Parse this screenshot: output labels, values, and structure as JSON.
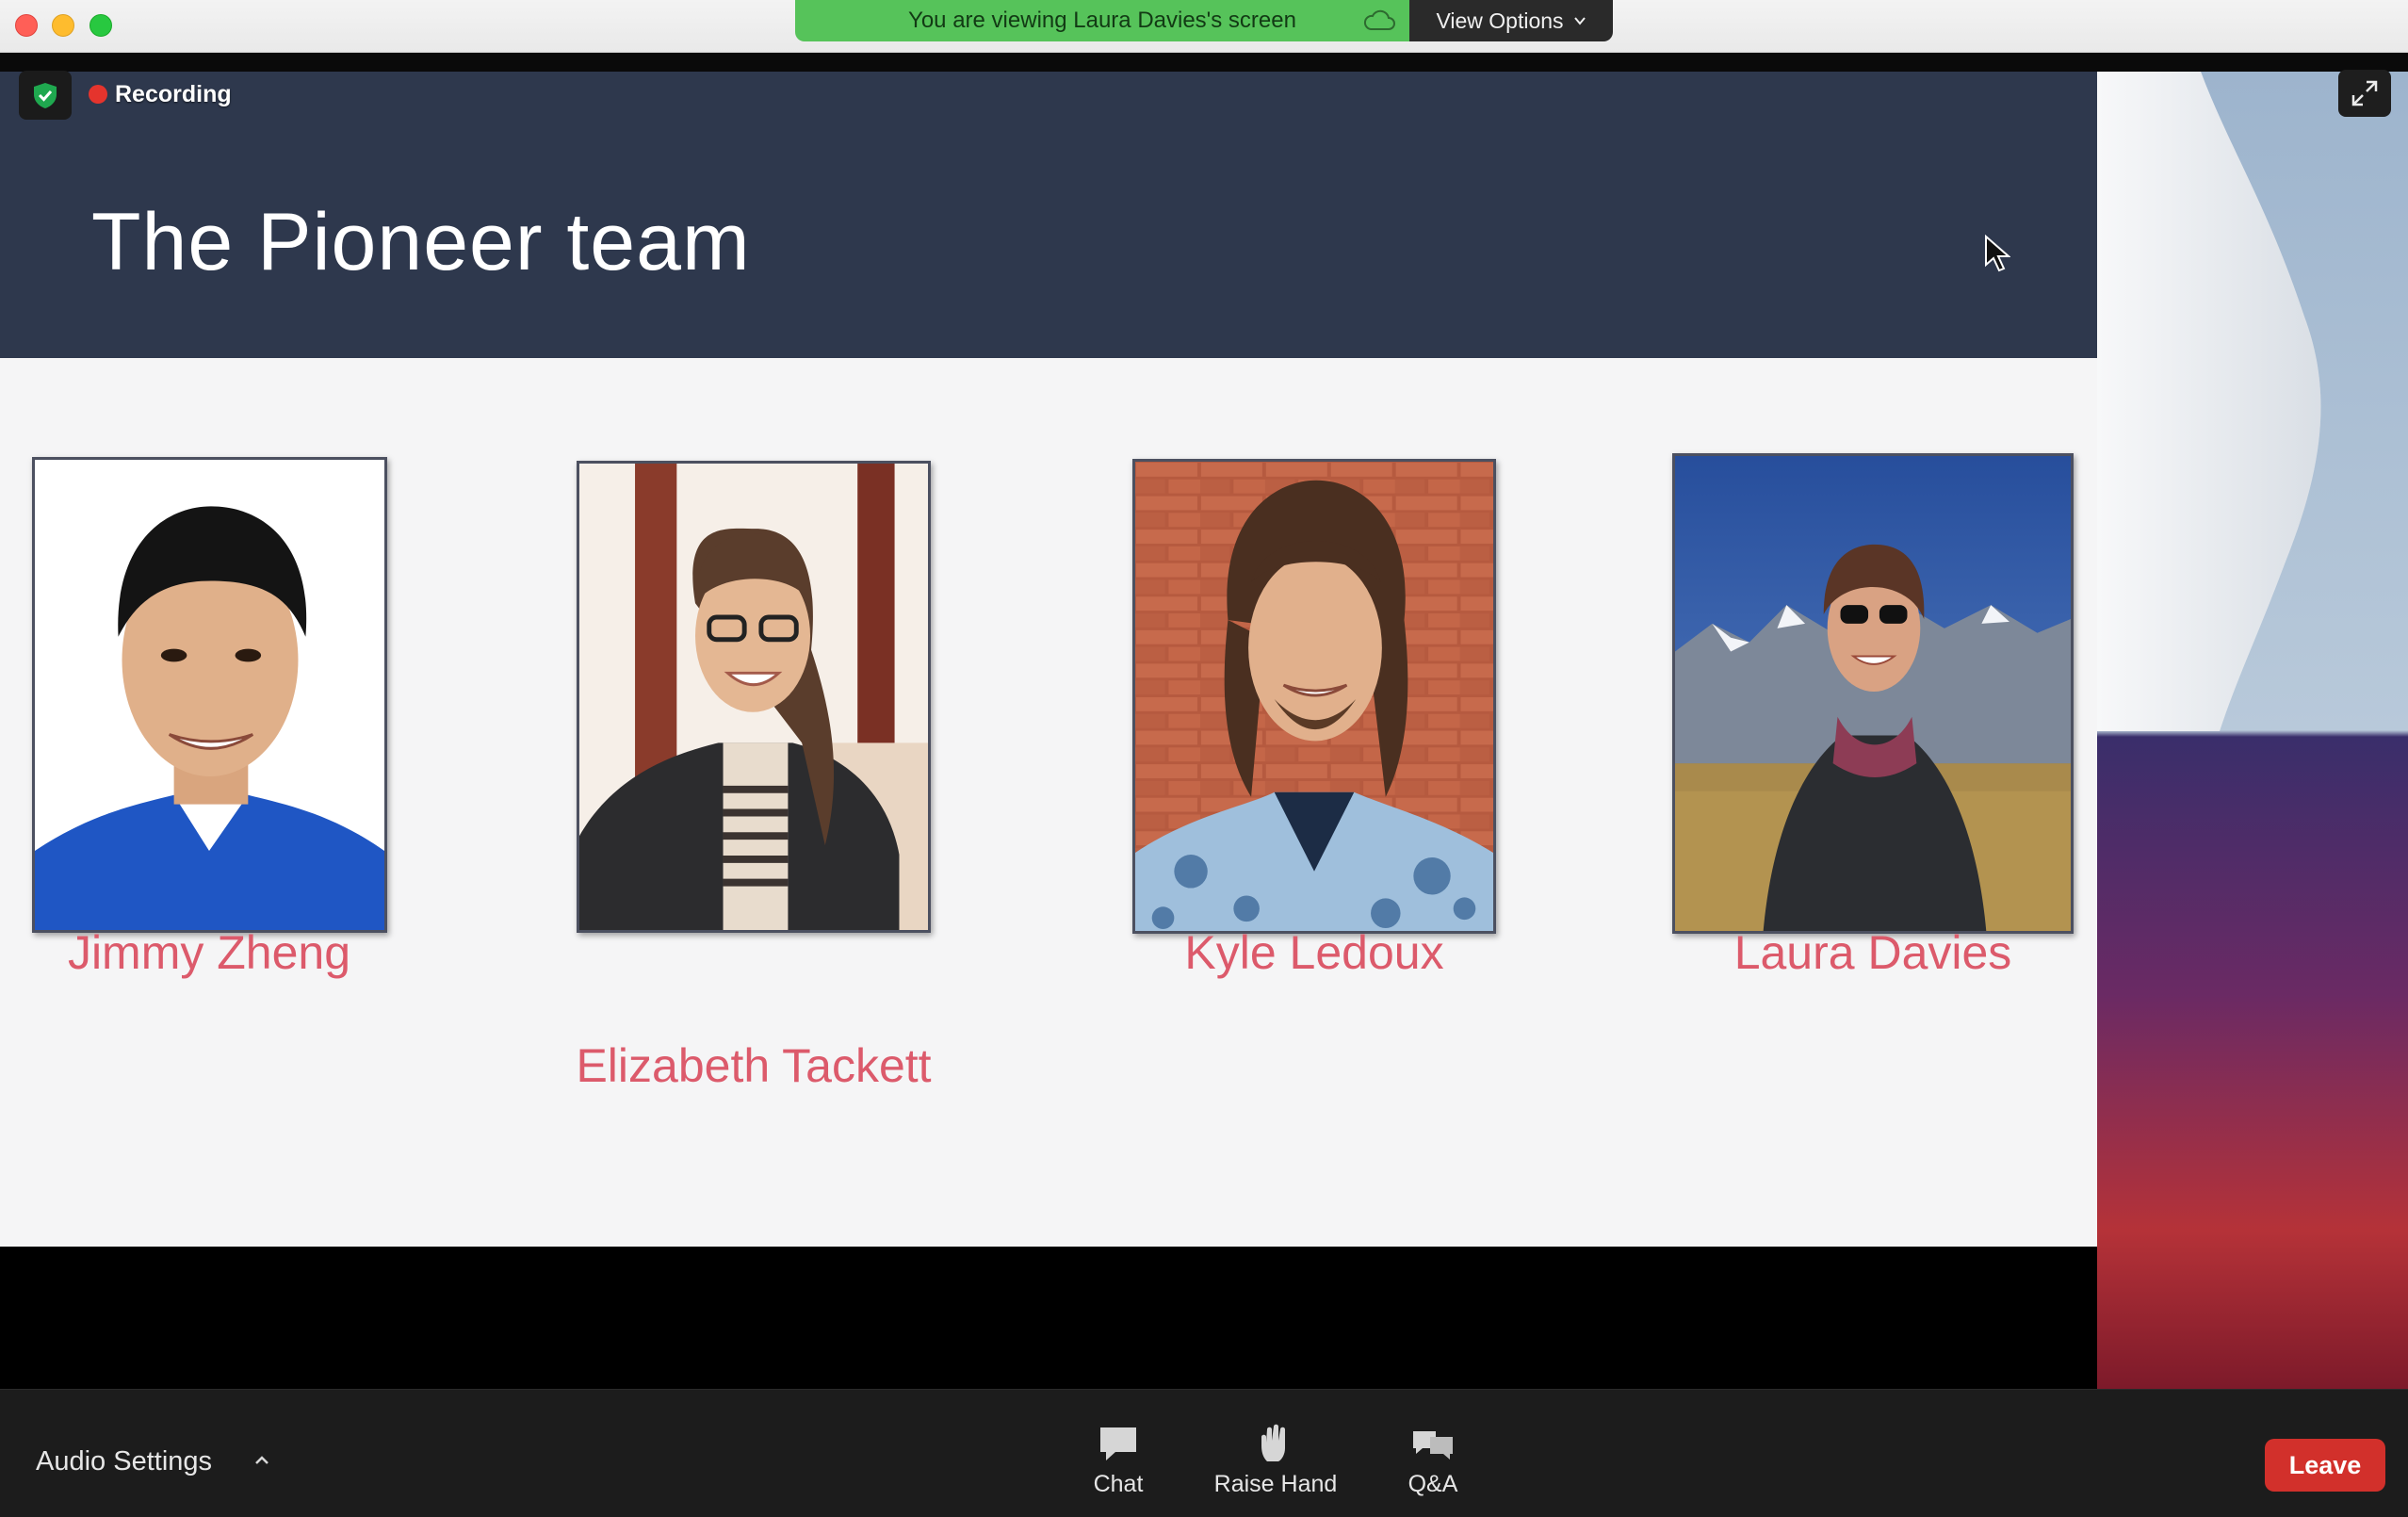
{
  "window": {
    "share_banner": "You are viewing Laura Davies's screen",
    "view_options_label": "View Options"
  },
  "meeting": {
    "recording_label": "Recording"
  },
  "slide": {
    "title": "The Pioneer team",
    "people": [
      {
        "name": "Jimmy Zheng"
      },
      {
        "name": "Elizabeth Tackett"
      },
      {
        "name": "Kyle Ledoux"
      },
      {
        "name": "Laura Davies"
      }
    ]
  },
  "toolbar": {
    "audio_settings_label": "Audio Settings",
    "chat_label": "Chat",
    "raise_hand_label": "Raise Hand",
    "qa_label": "Q&A",
    "leave_label": "Leave"
  },
  "colors": {
    "share_banner": "#56c35a",
    "slide_header": "#2e384d",
    "name_accent": "#dc5a6b",
    "leave_button": "#d2302b"
  },
  "icons": [
    "shield-check-icon",
    "cloud-icon",
    "chevron-down-icon",
    "expand-icon",
    "cursor-icon",
    "chevron-up-icon",
    "chat-icon",
    "raise-hand-icon",
    "qa-icon"
  ]
}
